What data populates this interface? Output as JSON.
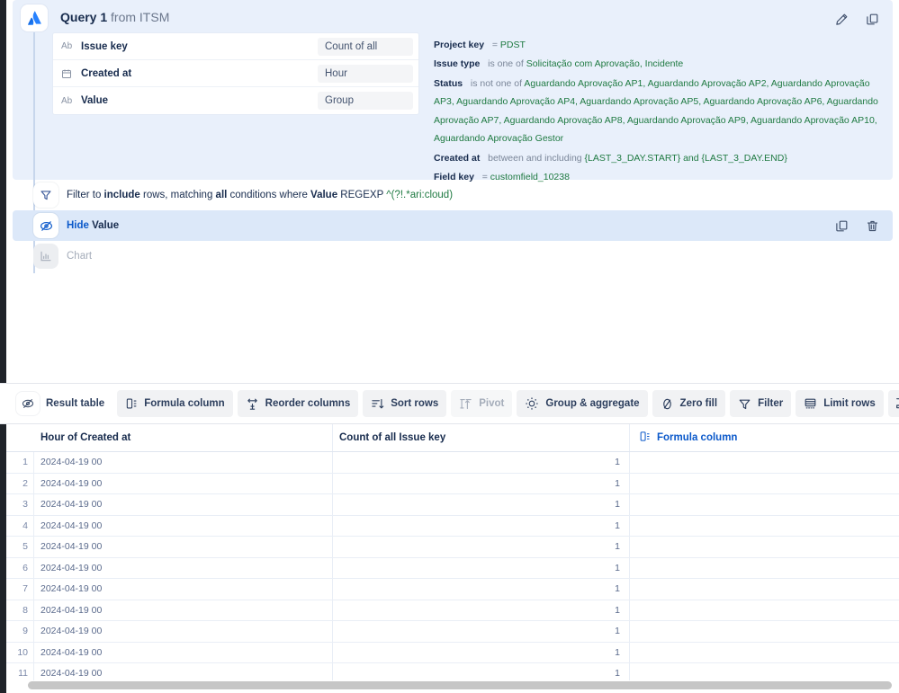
{
  "query": {
    "title": "Query 1",
    "from_label": "from",
    "source": "ITSM",
    "logo": "atlassian-logo",
    "edit_icon": "pencil-icon",
    "copy_icon": "copy-icon",
    "fields": [
      {
        "type_icon": "Ab",
        "name": "Issue key",
        "value": "Count of all"
      },
      {
        "type_icon": "calendar",
        "name": "Created at",
        "value": "Hour"
      },
      {
        "type_icon": "Ab",
        "name": "Value",
        "value": "Group"
      }
    ],
    "conditions": [
      {
        "key": "Project key",
        "op": "=",
        "value": "PDST"
      },
      {
        "key": "Issue type",
        "op": "is one of",
        "value": "Solicitação com Aprovação,  Incidente"
      },
      {
        "key": "Status",
        "op": "is not one of",
        "value": "Aguardando Aprovação AP1,  Aguardando Aprovação AP2,  Aguardando Aprovação AP3,  Aguardando Aprovação AP4,  Aguardando Aprovação AP5,  Aguardando Aprovação AP6,  Aguardando Aprovação AP7,  Aguardando Aprovação AP8,  Aguardando Aprovação AP9,  Aguardando Aprovação AP10,  Aguardando Aprovação Gestor"
      },
      {
        "key": "Created at",
        "op": "between and including",
        "value": "{LAST_3_DAY.START} and {LAST_3_DAY.END}"
      },
      {
        "key": "Field key",
        "op": "=",
        "value": "customfield_10238"
      }
    ]
  },
  "steps": {
    "filter": {
      "icon": "funnel-icon",
      "text_1": "Filter to ",
      "bold_1": "include",
      "text_2": " rows, matching ",
      "bold_2": "all",
      "text_3": " conditions where ",
      "bold_3": "Value",
      "text_4": " REGEXP ",
      "regex": "^(?!.*ari:cloud)"
    },
    "hide": {
      "icon": "eye-slash-icon",
      "link": "Hide",
      "bold": "Value",
      "copy_icon": "copy-icon",
      "delete_icon": "trash-icon"
    },
    "chart": {
      "icon": "bar-chart-icon",
      "label": "Chart"
    }
  },
  "toolbar": {
    "items": [
      {
        "label": "Result table",
        "icon": "eye-slash-icon",
        "style": "round",
        "disabled": false
      },
      {
        "label": "Formula column",
        "icon": "formula-column-icon",
        "style": "chip",
        "disabled": false
      },
      {
        "label": "Reorder columns",
        "icon": "reorder-columns-icon",
        "style": "chip",
        "disabled": false
      },
      {
        "label": "Sort rows",
        "icon": "sort-rows-icon",
        "style": "chip",
        "disabled": false
      },
      {
        "label": "Pivot",
        "icon": "pivot-icon",
        "style": "chip",
        "disabled": true
      },
      {
        "label": "Group & aggregate",
        "icon": "group-aggregate-icon",
        "style": "chip",
        "disabled": false
      },
      {
        "label": "Zero fill",
        "icon": "zero-fill-icon",
        "style": "chip",
        "disabled": false
      },
      {
        "label": "Filter",
        "icon": "funnel-icon",
        "style": "chip",
        "disabled": false
      },
      {
        "label": "Limit rows",
        "icon": "limit-rows-icon",
        "style": "chip",
        "disabled": false
      },
      {
        "label": "",
        "icon": "collapse-rows-icon",
        "style": "chip",
        "disabled": false
      }
    ]
  },
  "result_table": {
    "columns": [
      {
        "label": "Hour of Created at"
      },
      {
        "label": "Count of all Issue key"
      },
      {
        "label": "Formula column",
        "icon": "formula-column-icon",
        "is_link": true
      }
    ],
    "rows": [
      {
        "n": "1",
        "hour": "2024-04-19 00",
        "count": "1",
        "formula": ""
      },
      {
        "n": "2",
        "hour": "2024-04-19 00",
        "count": "1",
        "formula": ""
      },
      {
        "n": "3",
        "hour": "2024-04-19 00",
        "count": "1",
        "formula": ""
      },
      {
        "n": "4",
        "hour": "2024-04-19 00",
        "count": "1",
        "formula": ""
      },
      {
        "n": "5",
        "hour": "2024-04-19 00",
        "count": "1",
        "formula": ""
      },
      {
        "n": "6",
        "hour": "2024-04-19 00",
        "count": "1",
        "formula": ""
      },
      {
        "n": "7",
        "hour": "2024-04-19 00",
        "count": "1",
        "formula": ""
      },
      {
        "n": "8",
        "hour": "2024-04-19 00",
        "count": "1",
        "formula": ""
      },
      {
        "n": "9",
        "hour": "2024-04-19 00",
        "count": "1",
        "formula": ""
      },
      {
        "n": "10",
        "hour": "2024-04-19 00",
        "count": "1",
        "formula": ""
      },
      {
        "n": "11",
        "hour": "2024-04-19 00",
        "count": "1",
        "formula": ""
      }
    ]
  },
  "colors": {
    "card_bg": "#e9f0fb",
    "selected_step": "#dce8f9",
    "link": "#0a58ca",
    "value_green": "#1f7a42",
    "text": "#172b4d",
    "muted": "#7a8699"
  }
}
